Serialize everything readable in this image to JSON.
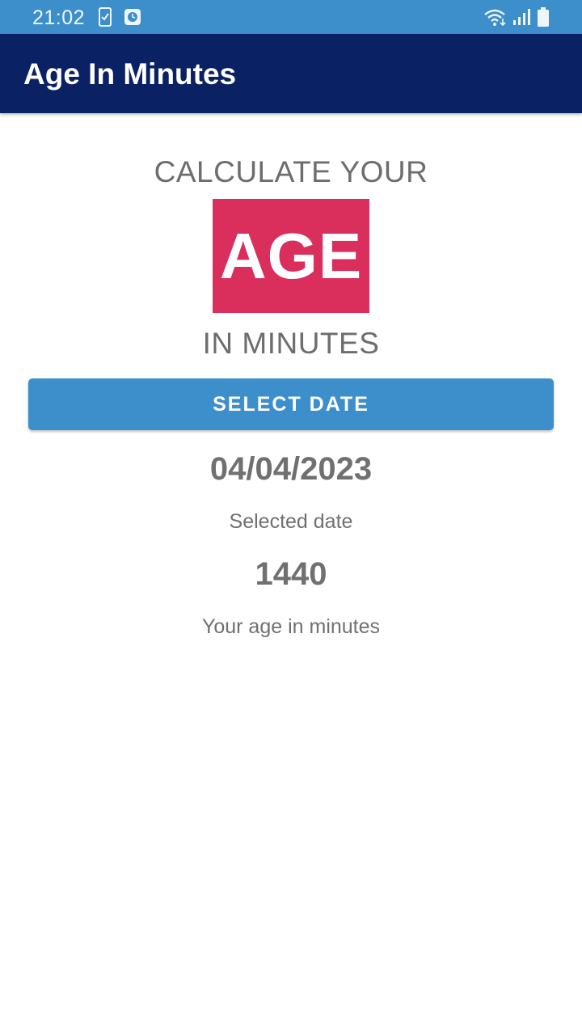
{
  "status_bar": {
    "time": "21:02",
    "icons": [
      "phone-checklist-icon",
      "clock-app-icon",
      "wifi-icon",
      "cell-signal-icon",
      "battery-icon"
    ]
  },
  "app_bar": {
    "title": "Age In Minutes"
  },
  "content": {
    "heading_top": "CALCULATE YOUR",
    "badge": "AGE",
    "heading_bottom": "IN MINUTES",
    "select_button_label": "SELECT DATE",
    "selected_date_value": "04/04/2023",
    "selected_date_label": "Selected date",
    "age_minutes_value": "1440",
    "age_minutes_label": "Your age in minutes"
  },
  "colors": {
    "status_bar": "#3d8fcc",
    "app_bar": "#0a2263",
    "badge": "#da2f5c",
    "button": "#3d8fcc",
    "text_gray": "#707070"
  }
}
